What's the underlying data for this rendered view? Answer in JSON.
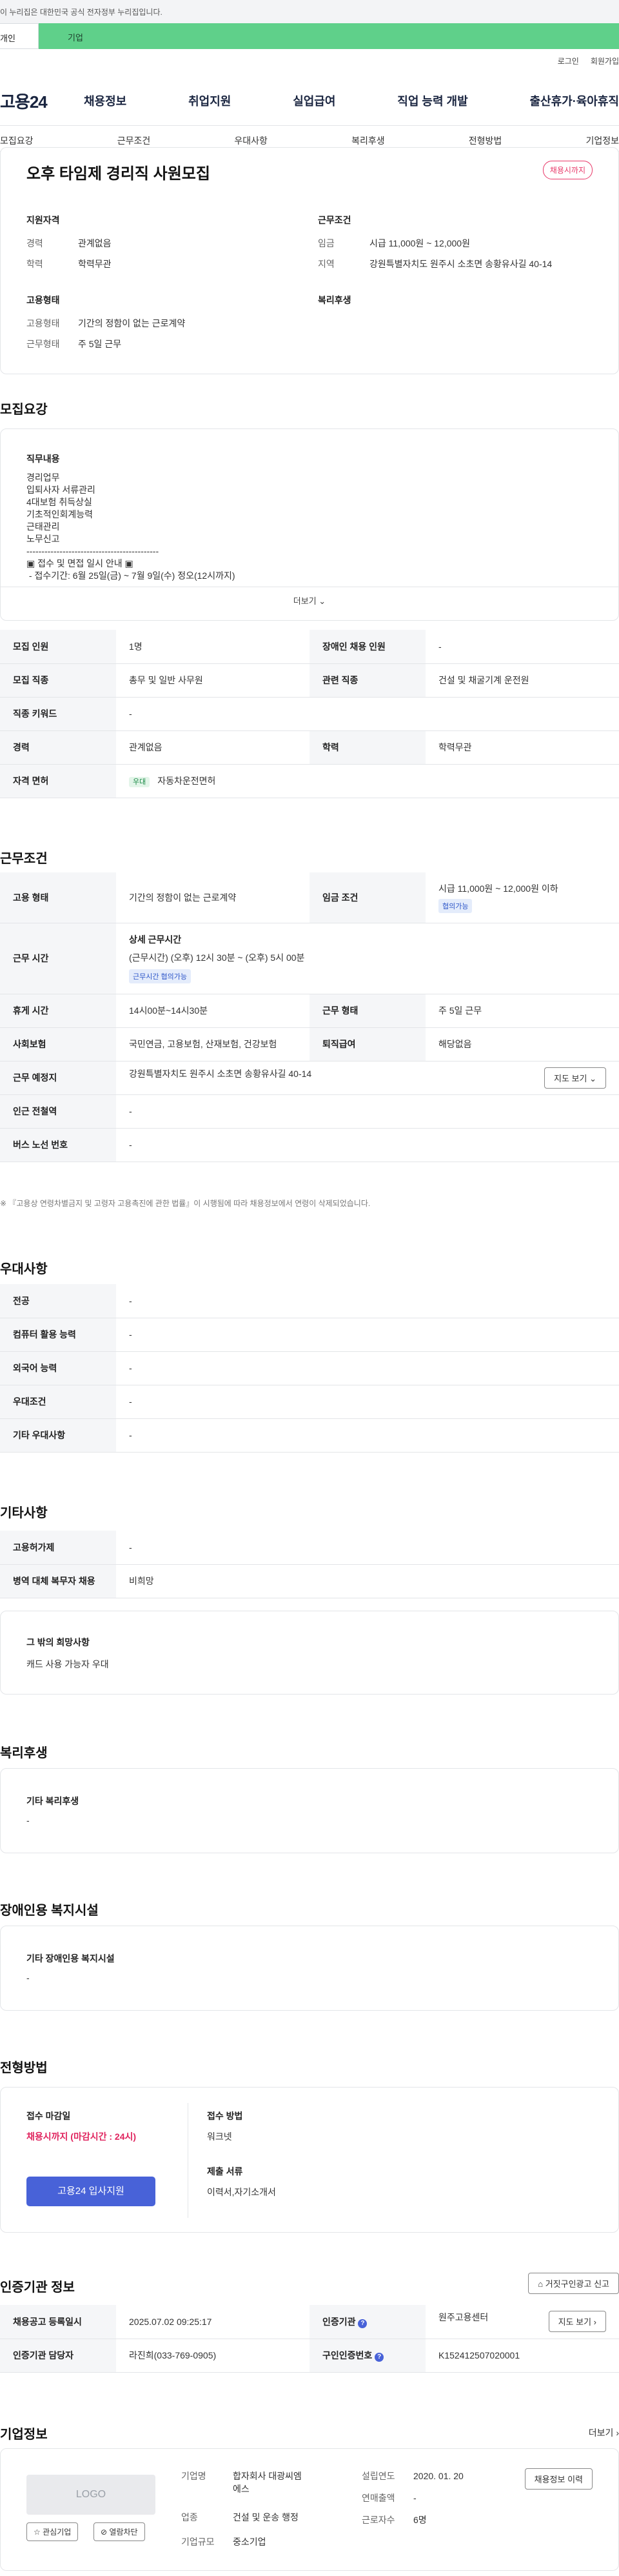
{
  "gov_banner": "이 누리집은 대한민국 공식 전자정부 누리집입니다.",
  "user_tabs": {
    "person": "개인",
    "biz": "기업"
  },
  "util_links": [
    "로그인",
    "회원가입"
  ],
  "header": {
    "logo": "고용24",
    "gnb": [
      "채용정보",
      "취업지원",
      "실업급여",
      "직업 능력 개발",
      "출산휴가·육아휴직"
    ]
  },
  "tab_nav": [
    "모집요강",
    "근무조건",
    "우대사항",
    "복리후생",
    "전형방법",
    "기업정보"
  ],
  "summary": {
    "title": "오후 타임제 경리직 사원모집",
    "badge": "채용시까지",
    "applicant_heading": "지원자격",
    "career_label": "경력",
    "career_value": "관계없음",
    "edu_label": "학력",
    "edu_value": "학력무관",
    "work_heading": "근무조건",
    "wage_label": "임금",
    "wage_value": "시급 11,000원 ~ 12,000원",
    "region_label": "지역",
    "region_value": "강원특별자치도 원주시 소초면 송황유사길 40-14",
    "employ_heading": "고용형태",
    "employ_type_label": "고용형태",
    "employ_type_value": "기간의 정함이 없는 근로계약",
    "work_form_label": "근무형태",
    "work_form_value": "주 5일 근무",
    "welfare_heading": "복리후생"
  },
  "recruit": {
    "heading": "모집요강",
    "duty_heading": "직무내용",
    "duty_text": "경리업무\n입퇴사자 서류관리\n4대보험 취득상실\n기초적인회계능력\n근태관리\n노무신고\n--------------------------------------------\n▣ 접수 및 면접 일시 안내 ▣\n - 접수기간: 6월 25일(금) ~ 7월 9일(수) 정오(12시까지)",
    "more": "더보기",
    "rows": [
      [
        "모집 인원",
        "1명",
        "장애인 채용 인원",
        "-"
      ],
      [
        "모집 직종",
        "총무 및 일반 사무원",
        "관련 직종",
        "건설 및 채굴기계 운전원"
      ],
      [
        "직종 키워드",
        "-"
      ],
      [
        "경력",
        "관계없음",
        "학력",
        "학력무관"
      ]
    ],
    "license_label": "자격 면허",
    "license_tag": "우대",
    "license_value": "자동차운전면허"
  },
  "conditions": {
    "heading": "근무조건",
    "employ_label": "고용 형태",
    "employ_value": "기간의 정함이 없는 근로계약",
    "wage_label": "임금 조건",
    "wage_value": "시급 11,000원 ~ 12,000원 이하",
    "wage_tag": "협의가능",
    "hours_label": "근무 시간",
    "hours_title": "상세 근무시간",
    "hours_value": "(근무시간) (오후) 12시 30분 ~ (오후) 5시 00분",
    "hours_tag": "근무시간 협의가능",
    "break_label": "휴게 시간",
    "break_value": "14시00분~14시30분",
    "form_label": "근무 형태",
    "form_value": "주 5일 근무",
    "insurance_label": "사회보험",
    "insurance_value": "국민연금, 고용보험, 산재보험, 건강보험",
    "retire_label": "퇴직급여",
    "retire_value": "해당없음",
    "place_label": "근무 예정지",
    "place_value": "강원특별자치도 원주시 소초면 송황유사길 40-14",
    "map_button": "지도 보기",
    "station_label": "인근 전철역",
    "station_value": "-",
    "bus_label": "버스 노선 번호",
    "bus_value": "-",
    "notice": "※ 『고용상 연령차별금지 및 고령자 고용촉진에 관한 법률』이 시행됨에 따라 채용정보에서 연령이 삭제되었습니다."
  },
  "preferences": {
    "heading": "우대사항",
    "rows": [
      [
        "전공",
        "-"
      ],
      [
        "컴퓨터 활용 능력",
        "-"
      ],
      [
        "외국어 능력",
        "-"
      ],
      [
        "우대조건",
        "-"
      ],
      [
        "기타 우대사항",
        "-"
      ]
    ]
  },
  "etc": {
    "heading": "기타사항",
    "rows": [
      [
        "고용허가제",
        "-"
      ],
      [
        "병역 대체 복무자 채용",
        "비희망"
      ]
    ],
    "other_heading": "그 밖의 희망사항",
    "other_value": "캐드 사용 가능자 우대"
  },
  "welfare": {
    "heading": "복리후생",
    "box_heading": "기타 복리후생",
    "box_value": "-"
  },
  "disabled": {
    "heading": "장애인용 복지시설",
    "box_heading": "기타 장애인용 복지시설",
    "box_value": "-"
  },
  "selection": {
    "heading": "전형방법",
    "deadline_label": "접수 마감일",
    "deadline_value": "채용시까지 (마감시간 : 24시)",
    "apply_button": "고용24 입사지원",
    "method_label": "접수 방법",
    "method_value": "워크넷",
    "docs_label": "제출 서류",
    "docs_value": "이력서,자기소개서"
  },
  "cert": {
    "heading": "인증기관 정보",
    "report_button": "거짓구인광고 신고",
    "reg_date_label": "채용공고 등록일시",
    "reg_date_value": "2025.07.02 09:25:17",
    "agency_label": "인증기관",
    "agency_value": "원주고용센터",
    "map_button": "지도 보기",
    "manager_label": "인증기관 담당자",
    "manager_value": "라진희(033-769-0905)",
    "number_label": "구인인증번호",
    "number_value": "K152412507020001"
  },
  "company": {
    "heading": "기업정보",
    "more": "더보기",
    "logo_placeholder": "LOGO",
    "fav_button": "관심기업",
    "block_button": "열람차단",
    "name_label": "기업명",
    "name_value": "합자회사 대광씨엠에스",
    "founded_label": "설립연도",
    "founded_value": "2020. 01. 20",
    "industry_label": "업종",
    "industry_value": "건설 및 운송 행정",
    "sales_label": "연매출액",
    "sales_value": "-",
    "scale_label": "기업규모",
    "scale_value": "중소기업",
    "staff_label": "근로자수",
    "staff_value": "6명",
    "jobs_button": "채용정보 이력"
  }
}
